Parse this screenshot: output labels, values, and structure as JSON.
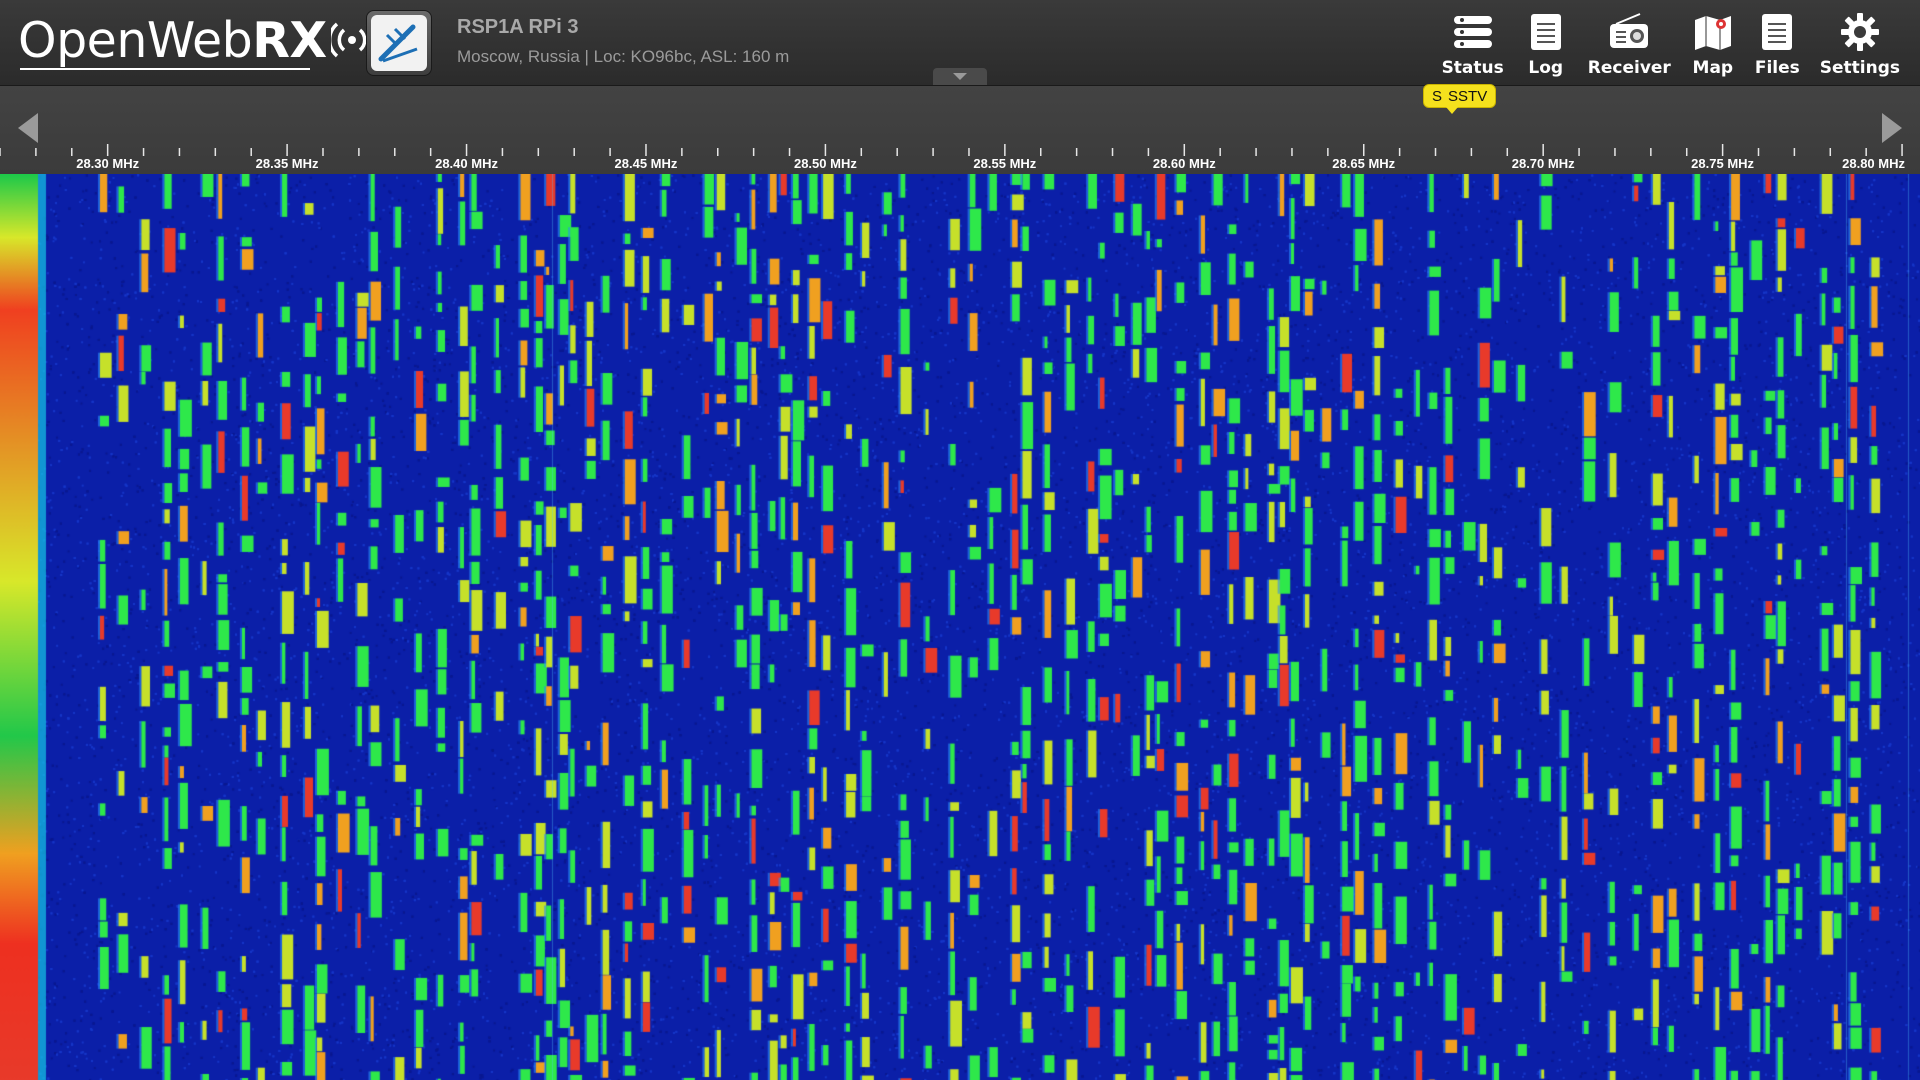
{
  "app": {
    "logo_text_regular": "OpenWeb",
    "logo_text_bold": "RX"
  },
  "receiver": {
    "name": "RSP1A RPi 3",
    "description": "Moscow, Russia | Loc: KO96bc, ASL: 160 m"
  },
  "nav": [
    {
      "label": "Status",
      "icon": "status-icon"
    },
    {
      "label": "Log",
      "icon": "log-icon"
    },
    {
      "label": "Receiver",
      "icon": "receiver-icon"
    },
    {
      "label": "Map",
      "icon": "map-icon"
    },
    {
      "label": "Files",
      "icon": "files-icon"
    },
    {
      "label": "Settings",
      "icon": "settings-icon"
    }
  ],
  "scale": {
    "labels": [
      "28.30 MHz",
      "28.35 MHz",
      "28.40 MHz",
      "28.45 MHz",
      "28.50 MHz",
      "28.55 MHz",
      "28.60 MHz",
      "28.65 MHz",
      "28.70 MHz",
      "28.75 MHz",
      "28.80 MHz"
    ],
    "start_mhz": 28.27,
    "end_mhz": 28.805
  },
  "bookmark": {
    "label_prefix": "S",
    "label": "SSTV"
  },
  "colors": {
    "waterfall_bg": "#0b1fa8",
    "signal_green": "#2ee84a",
    "signal_red": "#e83a2a",
    "bookmark": "#f5e11d"
  }
}
